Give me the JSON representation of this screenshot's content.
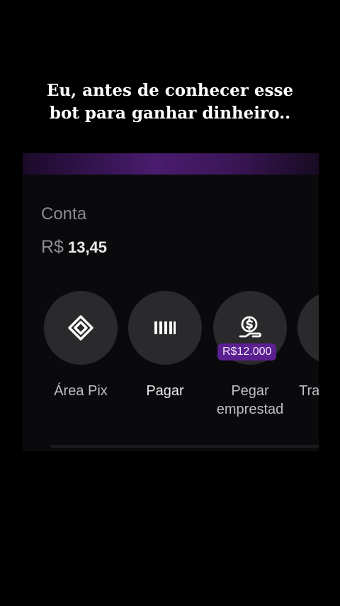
{
  "caption": {
    "line1": "Eu, antes de conhecer esse",
    "line2": "bot para ganhar dinheiro.."
  },
  "account": {
    "label": "Conta",
    "currency": "R$",
    "balance": "13,45"
  },
  "actions": [
    {
      "label": "Área Pix",
      "icon": "pix-icon"
    },
    {
      "label": "Pagar",
      "icon": "barcode-icon"
    },
    {
      "label_line1": "Pegar",
      "label_line2": "emprestad",
      "icon": "loan-icon",
      "badge": "R$12.000"
    },
    {
      "label": "Tra",
      "icon": "transfer-icon"
    }
  ],
  "colors": {
    "background": "#000000",
    "accent_purple": "#5b1f8f",
    "circle": "#2a2a2d"
  }
}
